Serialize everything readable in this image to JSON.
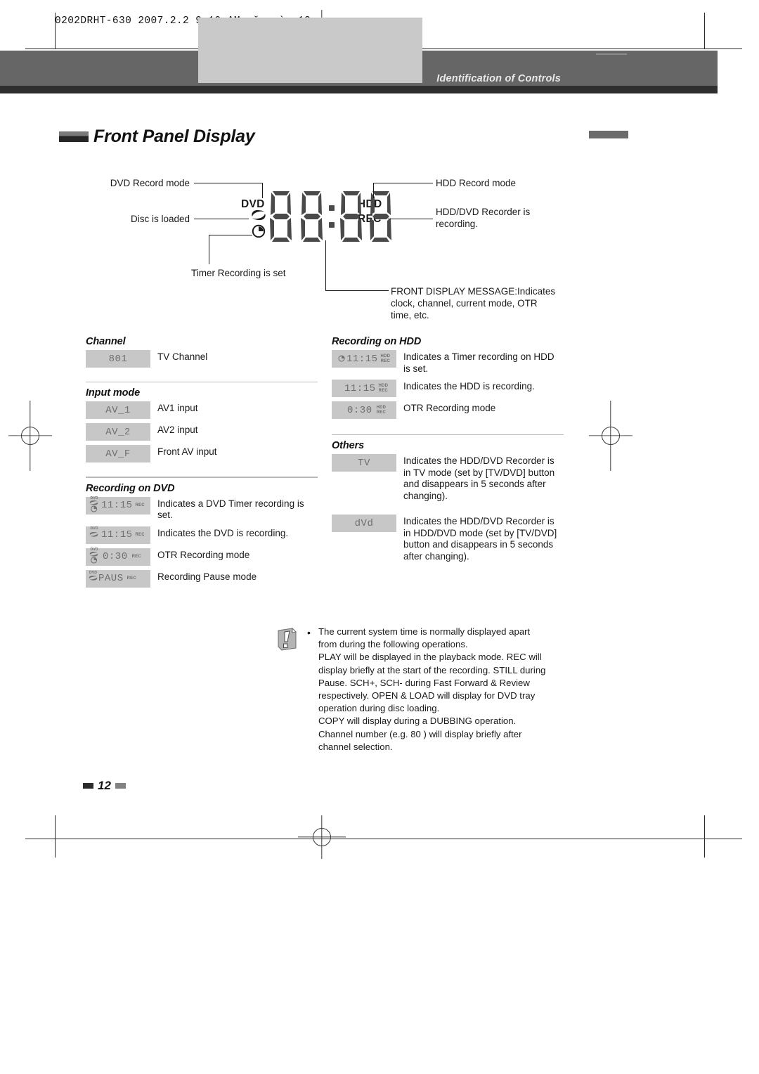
{
  "print": {
    "slug": "0202DRHT-630 2007.2.2 9:19 AM  ˘   `  12"
  },
  "header": {
    "running_head": "Identification of Controls"
  },
  "page": {
    "title": "Front Panel Display",
    "number": "12"
  },
  "diagram": {
    "lcd": {
      "dvd_label": "DVD",
      "hdd_label": "HDD",
      "rec_label": "REC",
      "digits": "88:88"
    },
    "callouts": {
      "dvd_record_mode": "DVD Record mode",
      "disc_is_loaded": "Disc is loaded",
      "timer_recording_is_set": "Timer Recording is set",
      "hdd_record_mode": "HDD Record mode",
      "recorder_is_recording": "HDD/DVD Recorder is\nrecording.",
      "front_display_message": "FRONT DISPLAY MESSAGE:Indicates\nclock, channel, current mode, OTR\ntime, etc."
    }
  },
  "sections": {
    "channel": {
      "heading": "Channel",
      "items": [
        {
          "chip_value": "801",
          "chip_dvd": false,
          "chip_hdd": false,
          "chip_rec": false,
          "chip_disc": false,
          "chip_timer": false,
          "desc": "TV Channel"
        }
      ]
    },
    "input_mode": {
      "heading": "Input mode",
      "items": [
        {
          "chip_value": "AV_1",
          "desc": "AV1 input"
        },
        {
          "chip_value": "AV_2",
          "desc": "AV2 input"
        },
        {
          "chip_value": "AV_F",
          "desc": "Front AV input"
        }
      ]
    },
    "recording_on_dvd": {
      "heading": "Recording on DVD",
      "items": [
        {
          "chip_value": "11:15",
          "chip_dvd": true,
          "chip_rec": "REC",
          "chip_disc": true,
          "chip_timer": true,
          "desc": "Indicates a DVD Timer recording is set."
        },
        {
          "chip_value": "11:15",
          "chip_dvd": true,
          "chip_rec": "REC",
          "chip_disc": true,
          "chip_timer": false,
          "desc": "Indicates the DVD is recording."
        },
        {
          "chip_value": "0:30",
          "chip_dvd": true,
          "chip_rec": "REC",
          "chip_disc": true,
          "chip_timer": true,
          "desc": "OTR Recording mode"
        },
        {
          "chip_value": "PAUS",
          "chip_dvd": true,
          "chip_rec": "REC",
          "chip_disc": true,
          "chip_timer": false,
          "desc": "Recording Pause mode"
        }
      ]
    },
    "recording_on_hdd": {
      "heading": "Recording on HDD",
      "items": [
        {
          "chip_value": "11:15",
          "chip_hdd": "HDD",
          "chip_rec": "REC",
          "chip_timer": true,
          "desc": "Indicates a Timer recording on HDD is set."
        },
        {
          "chip_value": "11:15",
          "chip_hdd": "HDD",
          "chip_rec": "REC",
          "chip_timer": false,
          "desc": "Indicates the HDD is recording."
        },
        {
          "chip_value": "0:30",
          "chip_hdd": "HDD",
          "chip_rec": "REC",
          "chip_timer": false,
          "desc": "OTR Recording mode"
        }
      ]
    },
    "others": {
      "heading": "Others",
      "items": [
        {
          "chip_value": "TV",
          "desc": "Indicates the HDD/DVD Recorder is in TV mode (set by [TV/DVD] button and disappears in 5 seconds after changing)."
        },
        {
          "chip_value": "dVd",
          "desc": "Indicates the HDD/DVD Recorder is in HDD/DVD mode (set by [TV/DVD] button and disappears in 5 seconds after changing)."
        }
      ]
    }
  },
  "note": {
    "bullet": "•",
    "line1": "The current system time is normally displayed apart from during the following operations.",
    "line2": "PLAY will be displayed in the playback mode. REC will display briefly at the start of the recording. STILL during Pause. SCH+, SCH- during Fast Forward & Review respectively. OPEN & LOAD will display for DVD tray operation during disc loading.",
    "line3": "COPY will display during a DUBBING operation. Channel number (e.g. 80 ) will display briefly after channel selection."
  }
}
